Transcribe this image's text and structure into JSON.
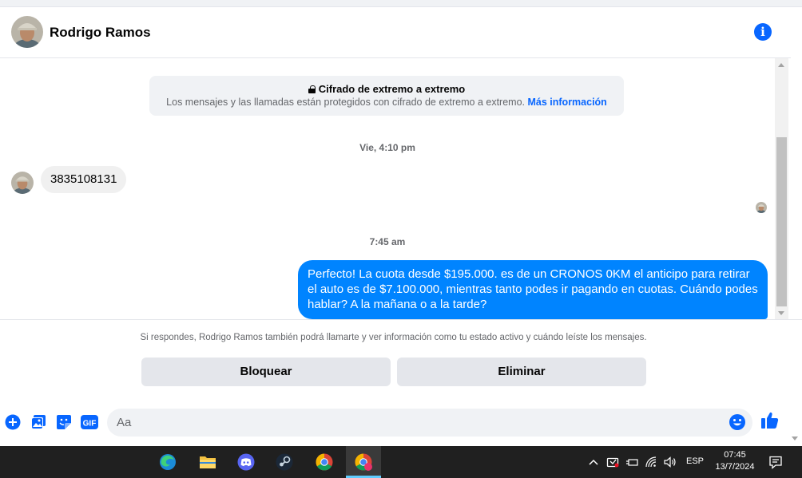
{
  "header": {
    "contact_name": "Rodrigo Ramos"
  },
  "encryption": {
    "title": "Cifrado de extremo a extremo",
    "description": "Los mensajes y las llamadas están protegidos con cifrado de extremo a extremo.",
    "link": "Más información"
  },
  "conversation": {
    "timestamp_1": "Vie, 4:10 pm",
    "incoming_message": "3835108131",
    "timestamp_2": "7:45 am",
    "outgoing_message": "Perfecto! La cuota desde $195.000. es de un CRONOS 0KM el anticipo para retirar el auto es de $7.100.000, mientras tanto podes ir pagando en cuotas. Cuándo podes hablar? A la mañana o a la tarde?"
  },
  "request_panel": {
    "notice": "Si respondes, Rodrigo Ramos también podrá llamarte y ver información como tu estado activo y cuándo leíste los mensajes.",
    "block_label": "Bloquear",
    "delete_label": "Eliminar"
  },
  "composer": {
    "placeholder": "Aa"
  },
  "taskbar": {
    "language": "ESP",
    "time": "07:45",
    "date": "13/7/2024"
  },
  "colors": {
    "accent": "#0866ff",
    "outgoing_bubble": "#0084ff",
    "incoming_bubble": "#f0f0f0",
    "taskbar": "#202020"
  }
}
